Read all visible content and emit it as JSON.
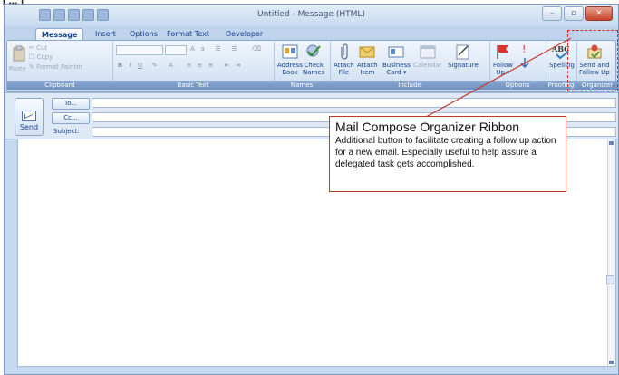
{
  "window": {
    "title": "Untitled - Message (HTML)",
    "controls": [
      "–",
      "▫",
      "✕"
    ]
  },
  "tabs": [
    {
      "label": "Message",
      "active": true
    },
    {
      "label": "Insert"
    },
    {
      "label": "Options"
    },
    {
      "label": "Format Text"
    },
    {
      "label": "Developer"
    }
  ],
  "clipboard": {
    "cut": "Cut",
    "copy": "Copy",
    "paste": "Paste",
    "format_painter": "Format Painter",
    "group": "Clipboard"
  },
  "basic_text": {
    "group": "Basic Text"
  },
  "names": {
    "address_book": "Address\nBook",
    "check_names": "Check\nNames",
    "group": "Names"
  },
  "include": {
    "attach_file": "Attach\nFile",
    "attach_item": "Attach\nItem",
    "business_card": "Business\nCard ▾",
    "calendar": "Calendar",
    "signature": "Signature",
    "group": "Include"
  },
  "options": {
    "follow_up": "Follow\nUp ▾",
    "group": "Options"
  },
  "proofing": {
    "spelling": "Spelling",
    "group": "Proofing"
  },
  "organizer": {
    "send_follow_up": "Send and\nFollow Up",
    "group": "Organizer"
  },
  "header": {
    "send": "Send",
    "to": "To...",
    "cc": "Cc...",
    "subject": "Subject:"
  },
  "callout": {
    "title": "Mail Compose Organizer Ribbon",
    "body": "Additional button to facilitate creating a follow up action for a new email.  Especially useful to help assure a delegated task gets accomplished."
  },
  "colors": {
    "ribbon": "#dbe7f6",
    "accent": "#15428b",
    "highlight": "#d62b1f"
  }
}
